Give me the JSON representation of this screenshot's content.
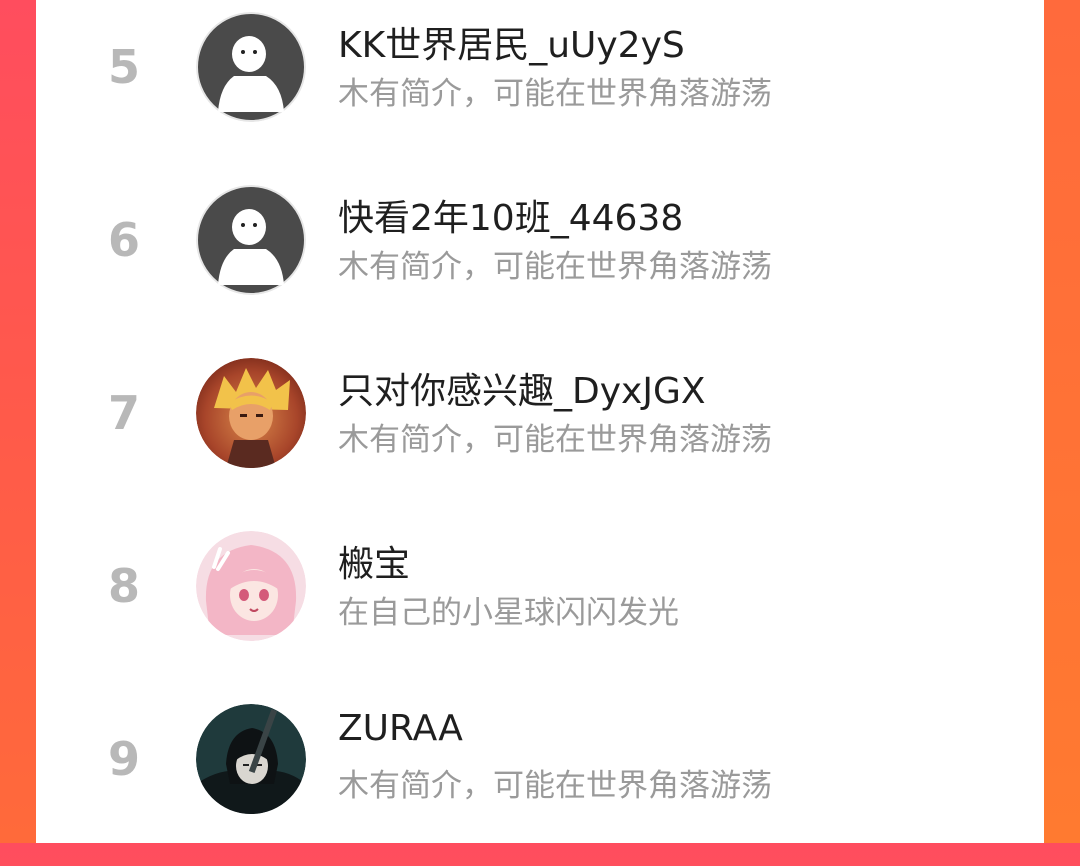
{
  "colors": {
    "accent_left": "#ff4d5e",
    "accent_right": "#ff6a3a",
    "rank": "#b8b8b8",
    "name": "#1f1f1f",
    "bio": "#9a9a9a"
  },
  "ranking": {
    "items": [
      {
        "rank": "5",
        "name": "KK世界居民_uUy2yS",
        "bio": "木有简介，可能在世界角落游荡",
        "avatar": "default-avatar-icon"
      },
      {
        "rank": "6",
        "name": "快看2年10班_44638",
        "bio": "木有简介，可能在世界角落游荡",
        "avatar": "default-avatar-icon"
      },
      {
        "rank": "7",
        "name": "只对你感兴趣_DyxJGX",
        "bio": "木有简介，可能在世界角落游荡",
        "avatar": "anime-avatar-blonde"
      },
      {
        "rank": "8",
        "name": "㮽宝",
        "bio": "在自己的小星球闪闪发光",
        "avatar": "anime-avatar-pink"
      },
      {
        "rank": "9",
        "name": "ZURAA",
        "bio": "木有简介，可能在世界角落游荡",
        "avatar": "anime-avatar-dark"
      }
    ]
  }
}
